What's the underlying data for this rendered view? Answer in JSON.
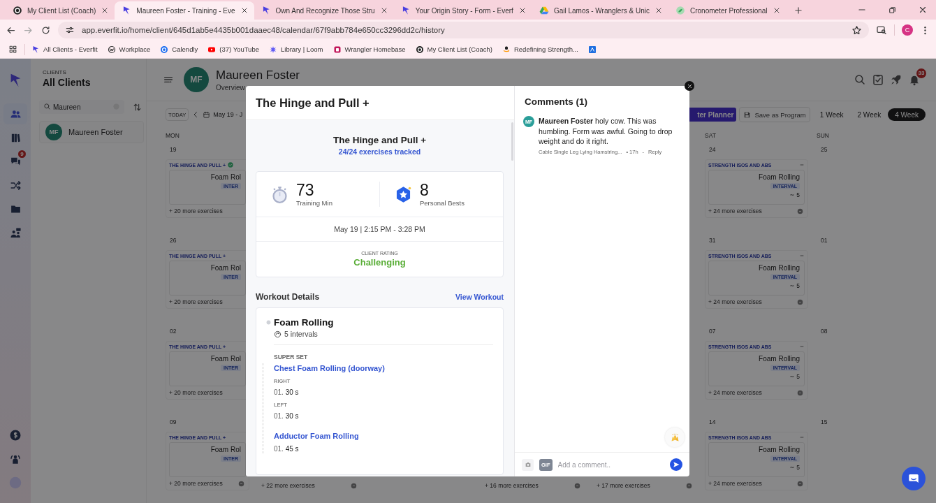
{
  "browser": {
    "tabs": [
      {
        "title": "My Client List (Coach)",
        "kind": "badge",
        "selected": false
      },
      {
        "title": "Maureen Foster - Training - Eve",
        "kind": "everfit",
        "selected": true
      },
      {
        "title": "Own And Recognize Those Stru",
        "kind": "everfit",
        "selected": false
      },
      {
        "title": "Your Origin Story - Form - Everf",
        "kind": "everfit",
        "selected": false
      },
      {
        "title": "Gail Lamos - Wranglers & Unic",
        "kind": "drive",
        "selected": false
      },
      {
        "title": "Cronometer Professional",
        "kind": "leaf",
        "selected": false
      }
    ],
    "address": "app.everfit.io/home/client/645d1ab5e4435b001daaec48/calendar/67f9abb784e650cc3296dd2c/history",
    "profile": "C",
    "bookmarks": [
      {
        "label": "All Clients - Everfit",
        "kind": "everfit"
      },
      {
        "label": "Workplace",
        "kind": "workplace"
      },
      {
        "label": "Calendly",
        "kind": "calendly"
      },
      {
        "label": "(37) YouTube",
        "kind": "youtube"
      },
      {
        "label": "Library | Loom",
        "kind": "loom"
      },
      {
        "label": "Wrangler Homebase",
        "kind": "homebase"
      },
      {
        "label": "My Client List (Coach)",
        "kind": "badge"
      },
      {
        "label": "Redefining Strength...",
        "kind": "amazon"
      },
      {
        "kind": "square"
      }
    ]
  },
  "sidebar": {
    "items": [
      {
        "kind": "clients",
        "selected": true
      },
      {
        "kind": "library",
        "selected": false
      },
      {
        "kind": "messages",
        "selected": false,
        "badge": "9"
      },
      {
        "kind": "autoflow",
        "selected": false
      },
      {
        "kind": "resources",
        "selected": false
      },
      {
        "kind": "team",
        "selected": false
      }
    ],
    "footer_items": [
      {
        "kind": "billing"
      },
      {
        "kind": "support"
      },
      {
        "kind": "account"
      }
    ]
  },
  "client_list": {
    "caption": "CLIENTS",
    "title": "All Clients",
    "search": "Maureen",
    "clients": [
      {
        "initials": "MF",
        "name": "Maureen Foster"
      }
    ]
  },
  "client_header": {
    "initials": "MF",
    "name": "Maureen Foster",
    "tab": "Overview",
    "notifications": "33"
  },
  "calendar_toolbar": {
    "today": "TODAY",
    "range": "May 19 - J",
    "planner": "ter Planner",
    "save": "Save as Program",
    "views": [
      {
        "label": "1 Week",
        "selected": false
      },
      {
        "label": "2 Week",
        "selected": false
      },
      {
        "label": "4 Week",
        "selected": true
      }
    ]
  },
  "calendar": {
    "columns": [
      {
        "day": "MON",
        "cells": [
          {
            "date": "19",
            "workout": "THE HINGE AND PULL +",
            "completed": true,
            "exercise": "Foam Rol",
            "badge": "INTER",
            "more": "+ 20 more exercises"
          },
          {
            "date": "26",
            "workout": "THE HINGE AND PULL +",
            "completed": false,
            "exercise": "Foam Rol",
            "badge": "INTER",
            "more": "+ 20 more exercises"
          },
          {
            "date": "02",
            "workout": "THE HINGE AND PULL +",
            "completed": false,
            "exercise": "Foam Rol",
            "badge": "INTER",
            "more": "+ 20 more exercises"
          },
          {
            "date": "09",
            "workout": "THE HINGE AND PULL +",
            "completed": false,
            "exercise": "Foam Rol",
            "badge": "INTER",
            "more": "+ 20 more exercises",
            "options_icon": true
          }
        ]
      },
      {
        "cells": [
          {},
          {},
          {},
          {
            "more": "+ 22 more exercises",
            "options_icon": true
          }
        ]
      },
      {},
      {
        "cells": [
          {},
          {},
          {},
          {
            "more": "+ 16 more exercises",
            "options_icon": true
          }
        ]
      },
      {
        "cells": [
          {},
          {},
          {},
          {
            "more": "+ 17 more exercises",
            "options_icon": true
          }
        ]
      },
      {
        "day": "SAT",
        "cells": [
          {
            "date": "24",
            "workout": "STRENGTH ISOS AND ABS",
            "completed": false,
            "collapse_icon": true,
            "exercise": "Foam Rolling",
            "badge": "INTERVAL",
            "rounds": "5",
            "more": "+ 24 more exercises",
            "options_icon": true
          },
          {
            "date": "31",
            "workout": "STRENGTH ISOS AND ABS",
            "completed": false,
            "collapse_icon": true,
            "exercise": "Foam Rolling",
            "badge": "INTERVAL",
            "rounds": "5",
            "more": "+ 24 more exercises",
            "options_icon": true
          },
          {
            "date": "07",
            "workout": "STRENGTH ISOS AND ABS",
            "completed": false,
            "collapse_icon": true,
            "exercise": "Foam Rolling",
            "badge": "INTERVAL",
            "rounds": "5",
            "more": "+ 24 more exercises",
            "options_icon": true
          },
          {
            "date": "14",
            "workout": "STRENGTH ISOS AND ABS",
            "completed": false,
            "collapse_icon": true,
            "exercise": "Foam Rolling",
            "badge": "INTERVAL",
            "rounds": "5",
            "more": "+ 24 more exercises",
            "options_icon": true
          }
        ]
      },
      {
        "day": "SUN",
        "cells": [
          {
            "date": "25"
          },
          {
            "date": "01"
          },
          {
            "date": "08"
          },
          {
            "date": "15"
          }
        ]
      }
    ]
  },
  "modal": {
    "title": "The Hinge and Pull +",
    "summary": {
      "title": "The Hinge and Pull +",
      "tracked": "24/24 exercises tracked",
      "stats": [
        {
          "kind": "time",
          "value": "73",
          "label": "Training Min"
        },
        {
          "kind": "bests",
          "value": "8",
          "label": "Personal Bests"
        }
      ],
      "date": "May 19 | 2:15 PM - 3:28 PM",
      "rating_label": "CLIENT RATING",
      "rating": "Challenging"
    },
    "details": {
      "title": "Workout Details",
      "link": "View Workout",
      "exercise": {
        "name": "Foam Rolling",
        "intervals": "5 intervals",
        "section": "SUPER SET",
        "items": [
          {
            "name": "Chest Foam Rolling (doorway)",
            "sides": [
              {
                "side": "RIGHT",
                "sets": [
                  "01. **30 s**"
                ]
              },
              {
                "side": "LEFT",
                "sets": [
                  "01. **30 s**"
                ]
              }
            ]
          },
          {
            "name": "Adductor Foam Rolling",
            "sets": [
              "01. **45 s**"
            ]
          }
        ]
      }
    },
    "comments": {
      "title": "Comments (1)",
      "items": [
        {
          "initials": "MF",
          "text": "**Maureen Foster** holy cow. This was humbling. Form was awful. Going to drop weight and do it right.",
          "exercise": "Cable Single Leg Lying Hamstring...",
          "time": "• 17h",
          "separator": "-",
          "reply": "Reply"
        }
      ],
      "gif": "GIF",
      "placeholder": "Add a comment.."
    }
  }
}
